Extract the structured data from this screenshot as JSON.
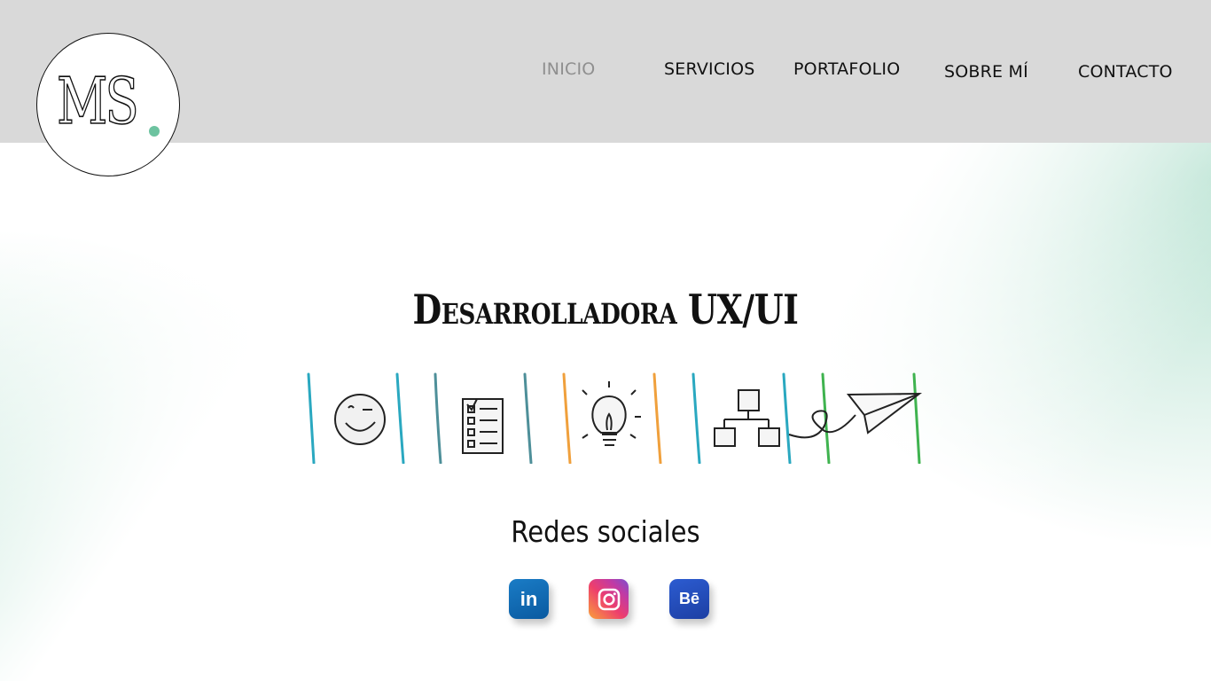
{
  "header": {
    "logo_text": "MS",
    "logo_accent_color": "#6dc3a0",
    "background_color": "#d9d9d9"
  },
  "nav": {
    "items": [
      {
        "label": "INICIO",
        "active": true
      },
      {
        "label": "SERVICIOS",
        "active": false
      },
      {
        "label": "PORTAFOLIO",
        "active": false
      },
      {
        "label": "SOBRE MÍ",
        "active": false
      },
      {
        "label": "CONTACTO",
        "active": false
      }
    ]
  },
  "hero": {
    "title": "Desarrolladora UX/UI",
    "banner_icons": [
      "smile-wink-icon",
      "checklist-icon",
      "lightbulb-icon",
      "sitemap-icon",
      "paper-plane-icon"
    ]
  },
  "social": {
    "title": "Redes sociales",
    "links": [
      {
        "name": "linkedin",
        "label": "in",
        "icon": "linkedin-icon"
      },
      {
        "name": "instagram",
        "label": "",
        "icon": "instagram-icon"
      },
      {
        "name": "behance",
        "label": "Bē",
        "icon": "behance-icon"
      }
    ]
  },
  "colors": {
    "accent_mint": "#b2e0ce",
    "text": "#111111",
    "nav_active": "#8f8f8f"
  }
}
